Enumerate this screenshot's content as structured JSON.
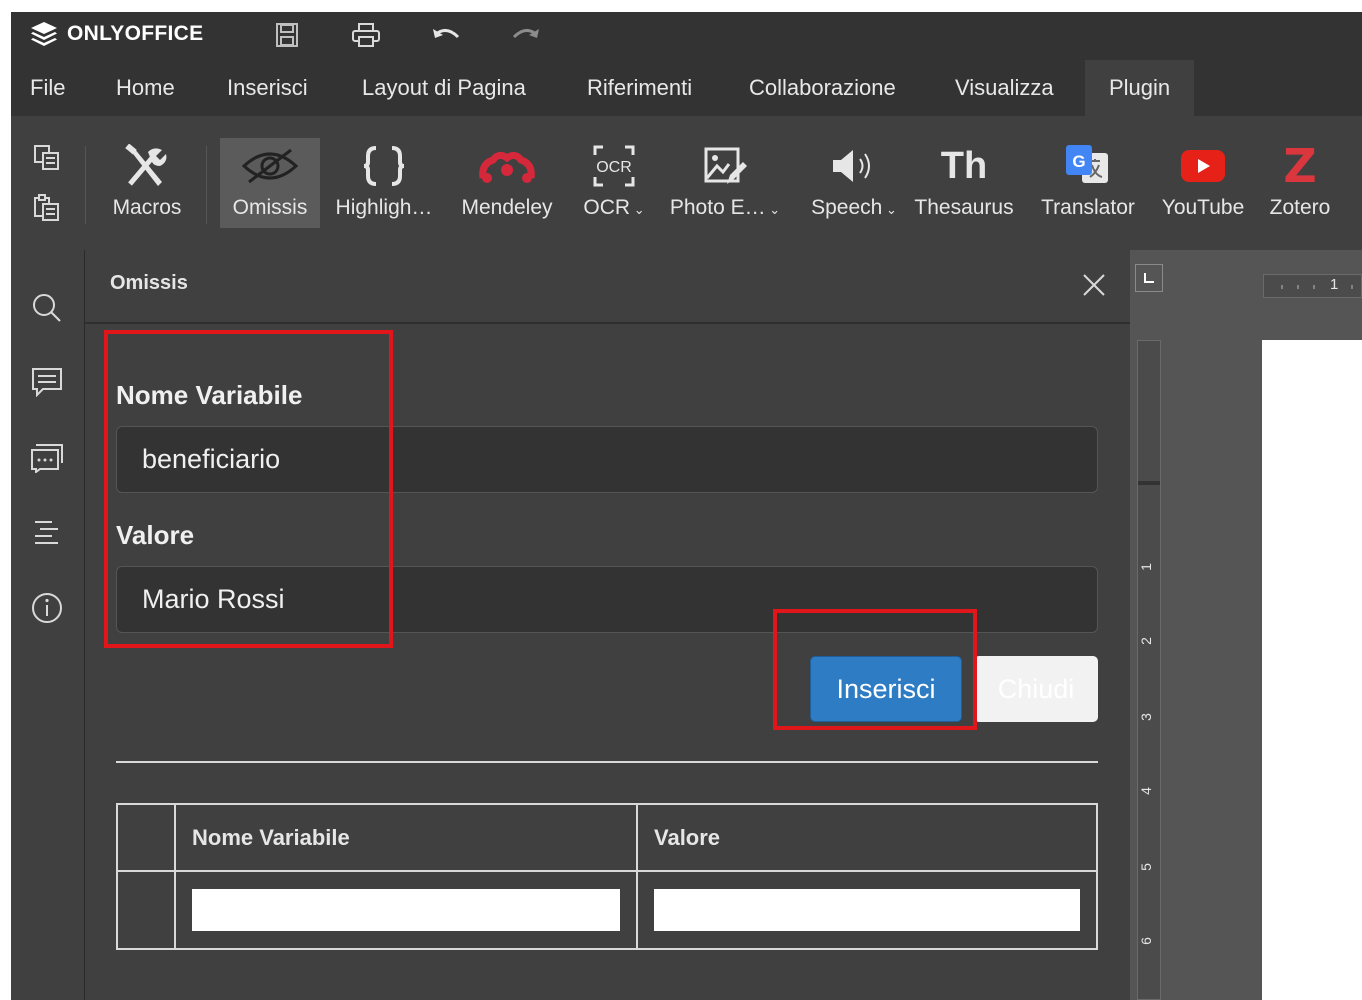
{
  "app": {
    "name": "ONLYOFFICE"
  },
  "menu": {
    "items": [
      {
        "id": "file",
        "label": "File"
      },
      {
        "id": "home",
        "label": "Home"
      },
      {
        "id": "inserisci",
        "label": "Inserisci"
      },
      {
        "id": "layout",
        "label": "Layout di Pagina"
      },
      {
        "id": "riferimenti",
        "label": "Riferimenti"
      },
      {
        "id": "collaborazione",
        "label": "Collaborazione"
      },
      {
        "id": "visualizza",
        "label": "Visualizza"
      },
      {
        "id": "plugin",
        "label": "Plugin"
      }
    ],
    "active": "Plugin"
  },
  "toolbar": {
    "plugins": [
      {
        "id": "macros",
        "label": "Macros",
        "icon": "tools-icon"
      },
      {
        "id": "omissis",
        "label": "Omissis",
        "icon": "eye-slash-icon",
        "selected": true
      },
      {
        "id": "highlight",
        "label": "Highligh…",
        "icon": "braces-icon"
      },
      {
        "id": "mendeley",
        "label": "Mendeley",
        "icon": "mendeley-icon"
      },
      {
        "id": "ocr",
        "label": "OCR",
        "icon": "ocr-icon",
        "dropdown": true
      },
      {
        "id": "photo",
        "label": "Photo E…",
        "icon": "photo-editor-icon",
        "dropdown": true
      },
      {
        "id": "speech",
        "label": "Speech",
        "icon": "speaker-icon",
        "dropdown": true
      },
      {
        "id": "thesaurus",
        "label": "Thesaurus",
        "icon": "thesaurus-icon",
        "glyph": "Th"
      },
      {
        "id": "translator",
        "label": "Translator",
        "icon": "google-translate-icon"
      },
      {
        "id": "youtube",
        "label": "YouTube",
        "icon": "youtube-icon"
      },
      {
        "id": "zotero",
        "label": "Zotero",
        "icon": "zotero-icon",
        "glyph": "Z"
      }
    ]
  },
  "panel": {
    "title": "Omissis",
    "name_label": "Nome Variabile",
    "name_value": "beneficiario",
    "value_label": "Valore",
    "value_value": "Mario Rossi",
    "insert_button": "Inserisci",
    "close_button": "Chiudi",
    "table": {
      "headers": [
        "",
        "Nome Variabile",
        "Valore"
      ]
    }
  },
  "ruler": {
    "h_label": "1",
    "v_labels": [
      "1",
      "2",
      "3",
      "4",
      "5",
      "6"
    ]
  },
  "colors": {
    "accent": "#2d7cc4",
    "highlight": "#e0161b",
    "background": "#404040",
    "zotero": "#d9363e",
    "youtube": "#e62117",
    "mendeley": "#d6283b"
  }
}
